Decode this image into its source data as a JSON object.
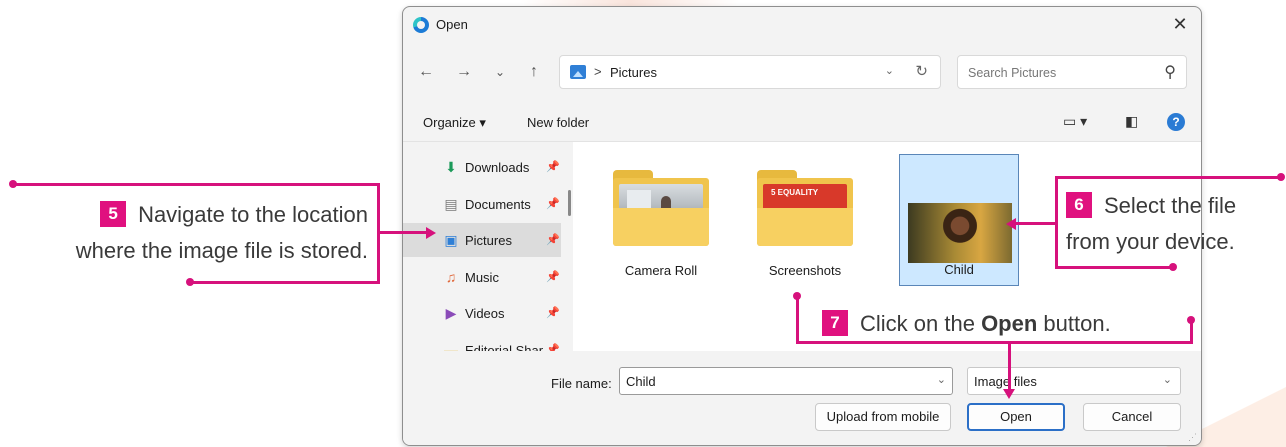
{
  "dialog": {
    "title": "Open",
    "close_glyph": "✕",
    "icons": {
      "app": "browser-app-icon",
      "close": "close-icon"
    }
  },
  "nav": {
    "back": "←",
    "forward": "→",
    "recent": "⌄",
    "up": "↑",
    "crumb_sep": ">",
    "location": "Pictures",
    "dropdown": "⌄",
    "refresh": "↻",
    "search_placeholder": "Search Pictures",
    "search_glyph": "⚲"
  },
  "toolbar": {
    "organize": "Organize ▾",
    "new_folder": "New folder",
    "view_glyph": "▭ ▾",
    "pane_glyph": "◧",
    "help": "?"
  },
  "sidebar": {
    "pin_glyph": "📌",
    "items": [
      {
        "label": "Downloads",
        "glyph": "⬇",
        "color": "#1c9a5a",
        "selected": false
      },
      {
        "label": "Documents",
        "glyph": "▤",
        "color": "#7a7a7a",
        "selected": false
      },
      {
        "label": "Pictures",
        "glyph": "▣",
        "color": "#2f7fd6",
        "selected": true
      },
      {
        "label": "Music",
        "glyph": "♫",
        "color": "#e0683a",
        "selected": false
      },
      {
        "label": "Videos",
        "glyph": "▶",
        "color": "#8a4bb8",
        "selected": false
      },
      {
        "label": "Editorial Shar",
        "glyph": "▬",
        "color": "#e7b93e",
        "selected": false
      }
    ]
  },
  "files": [
    {
      "label": "Camera Roll",
      "type": "folder",
      "selected": false
    },
    {
      "label": "Screenshots",
      "type": "folder",
      "selected": false,
      "thumb_text": "5 EQUALITY"
    },
    {
      "label": "Child",
      "type": "image",
      "selected": true
    }
  ],
  "footer": {
    "file_name_label": "File name:",
    "file_name_value": "Child",
    "file_type": "Image files",
    "combo_glyph": "⌄",
    "upload_mobile": "Upload from mobile",
    "open": "Open",
    "cancel": "Cancel"
  },
  "callouts": {
    "step5": {
      "number": "5",
      "line1": "Navigate to the location",
      "line2": "where the image file is stored."
    },
    "step6": {
      "number": "6",
      "line1": "Select the file",
      "line2": "from your device."
    },
    "step7": {
      "number": "7",
      "pre": "Click on the ",
      "bold": "Open",
      "post": " button."
    }
  },
  "colors": {
    "accent_pink": "#d6117c",
    "badge_pink": "#e0117f",
    "selection_blue": "#cde8ff",
    "primary_border": "#2b6fc7"
  }
}
